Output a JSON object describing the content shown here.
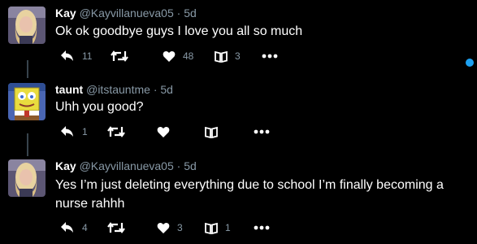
{
  "tweets": [
    {
      "name": "Kay",
      "handle": "@Kayvillanueva05",
      "separator": "·",
      "time": "5d",
      "text": "Ok ok goodbye guys I love you all so much",
      "replies": "11",
      "retweets": "",
      "likes": "48",
      "shares": "3",
      "avatar": "avatar-photo-blonde"
    },
    {
      "name": "taunt",
      "handle": "@itstauntme",
      "separator": "·",
      "time": "5d",
      "text": "Uhh you good?",
      "replies": "1",
      "retweets": "",
      "likes": "",
      "shares": "",
      "avatar": "avatar-cartoon-sponge"
    },
    {
      "name": "Kay",
      "handle": "@Kayvillanueva05",
      "separator": "·",
      "time": "5d",
      "text": "Yes I’m just deleting everything due to school I’m finally becoming a nurse rahhh",
      "replies": "4",
      "retweets": "",
      "likes": "3",
      "shares": "1",
      "avatar": "avatar-photo-blonde"
    }
  ],
  "icons": {
    "reply": "reply-icon",
    "retweet": "retweet-icon",
    "like": "heart-icon",
    "share": "book-icon",
    "more": "more-icon"
  },
  "colors": {
    "background": "#000000",
    "text": "#ffffff",
    "muted": "#8899a6",
    "accent": "#1da1f2",
    "thread_line": "#38444d"
  }
}
